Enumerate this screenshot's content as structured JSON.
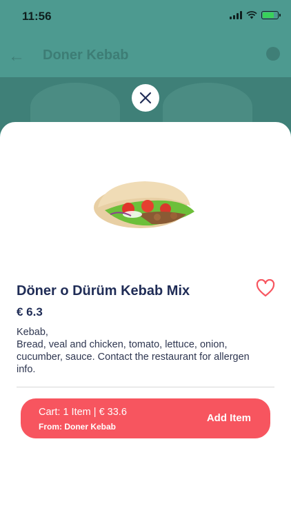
{
  "status_bar": {
    "time": "11:56"
  },
  "background_screen": {
    "title": "Doner Kebab"
  },
  "product": {
    "name": "Döner o Dürüm Kebab Mix",
    "price": "€ 6.3",
    "description_lines": [
      "Kebab,",
      "Bread, veal and chicken, tomato, lettuce, onion,",
      "cucumber, sauce. Contact the restaurant for allergen",
      "info."
    ]
  },
  "cart": {
    "summary": "Cart: 1 Item | € 33.6",
    "from": "From: Doner Kebab",
    "add_label": "Add Item"
  },
  "icons": {
    "close": "close-icon",
    "favorite": "heart-icon",
    "back": "back-arrow-icon"
  },
  "colors": {
    "accent": "#f7555f",
    "title": "#1f2c56",
    "backdrop": "#4d9a90"
  }
}
